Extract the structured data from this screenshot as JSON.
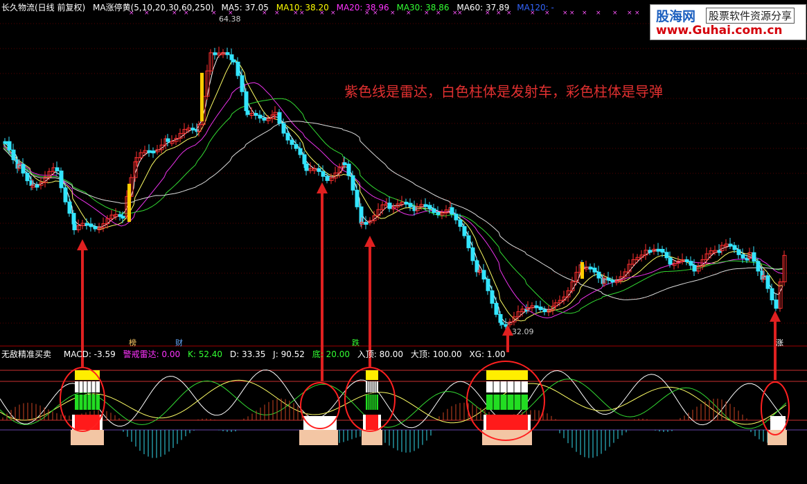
{
  "header": {
    "stock_title": "长久物流(日线 前复权)",
    "ma_indicator_name": "MA涨停黄(5,10,20,30,60,250)",
    "ma_values": [
      {
        "label": "MA5: 37.05",
        "color": "#ffffff"
      },
      {
        "label": "MA10: 38.20",
        "color": "#ffff00"
      },
      {
        "label": "MA20: 38.96",
        "color": "#ff33ff"
      },
      {
        "label": "MA30: 38.86",
        "color": "#33ff33"
      },
      {
        "label": "MA60: 37.89",
        "color": "#ffffff"
      },
      {
        "label": "MA120: -",
        "color": "#3366ff"
      }
    ]
  },
  "logo": {
    "title": "股海网",
    "tagline": "股票软件资源分享",
    "url": "www.Guhai.com.cn"
  },
  "annotation": "紫色线是雷达，白色柱体是发射车，彩色柱体是导弹",
  "price_labels": {
    "high": "64.38",
    "low": "32.09"
  },
  "event_tags": [
    {
      "text": "榜",
      "color": "#ffcc66"
    },
    {
      "text": "财",
      "color": "#66aaff"
    },
    {
      "text": "跌",
      "color": "#33ff33"
    },
    {
      "text": "涨",
      "color": "#ffffff"
    }
  ],
  "indicator": {
    "name": "无敌精准买卖",
    "values": [
      {
        "label": "MACD: -3.59",
        "color": "#ffffff"
      },
      {
        "label": "警戒雷达: 0.00",
        "color": "#ff33ff"
      },
      {
        "label": "K: 52.40",
        "color": "#33ff33"
      },
      {
        "label": "D: 33.35",
        "color": "#ffffff"
      },
      {
        "label": "J: 90.52",
        "color": "#ffffff"
      },
      {
        "label": "底: 20.00",
        "color": "#33ff33"
      },
      {
        "label": "入顶: 80.00",
        "color": "#ffffff"
      },
      {
        "label": "大顶: 100.00",
        "color": "#ffffff"
      },
      {
        "label": "XG: 1.00",
        "color": "#ffffff"
      }
    ]
  },
  "colors": {
    "background": "#000000",
    "up": "#ff3030",
    "down": "#33e5ff",
    "arrow": "#e02020",
    "divider": "#a00000"
  }
}
